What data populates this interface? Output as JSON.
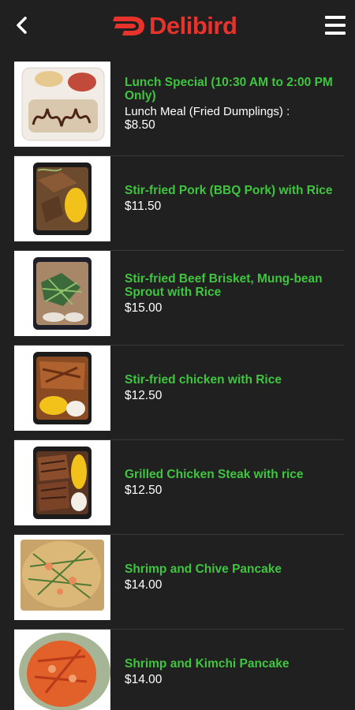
{
  "header": {
    "back_icon": "back-arrow-icon",
    "logo_text": "Delibird",
    "menu_icon": "hamburger-menu-icon",
    "brand_color": "#e8322c"
  },
  "colors": {
    "background": "#202020",
    "item_name": "#3fc53f",
    "price": "#ffffff"
  },
  "menu_items": [
    {
      "name": "Lunch Special (10:30 AM to 2:00 PM Only)",
      "description": "Lunch Meal (Fried Dumplings) :",
      "price": "$8.50",
      "image": "dumpling-lunch-box-image"
    },
    {
      "name": "Stir-fried Pork (BBQ Pork) with Rice",
      "description": "",
      "price": "$11.50",
      "image": "bbq-pork-rice-image"
    },
    {
      "name": "Stir-fried Beef Brisket, Mung-bean Sprout with Rice",
      "description": "",
      "price": "$15.00",
      "image": "beef-brisket-rice-image"
    },
    {
      "name": "Stir-fried chicken with Rice",
      "description": "",
      "price": "$12.50",
      "image": "stir-fried-chicken-rice-image"
    },
    {
      "name": "Grilled Chicken Steak with rice",
      "description": "",
      "price": "$12.50",
      "image": "grilled-chicken-steak-image"
    },
    {
      "name": "Shrimp and Chive Pancake",
      "description": "",
      "price": "$14.00",
      "image": "shrimp-chive-pancake-image"
    },
    {
      "name": "Shrimp and Kimchi Pancake",
      "description": "",
      "price": "$14.00",
      "image": "shrimp-kimchi-pancake-image"
    }
  ]
}
